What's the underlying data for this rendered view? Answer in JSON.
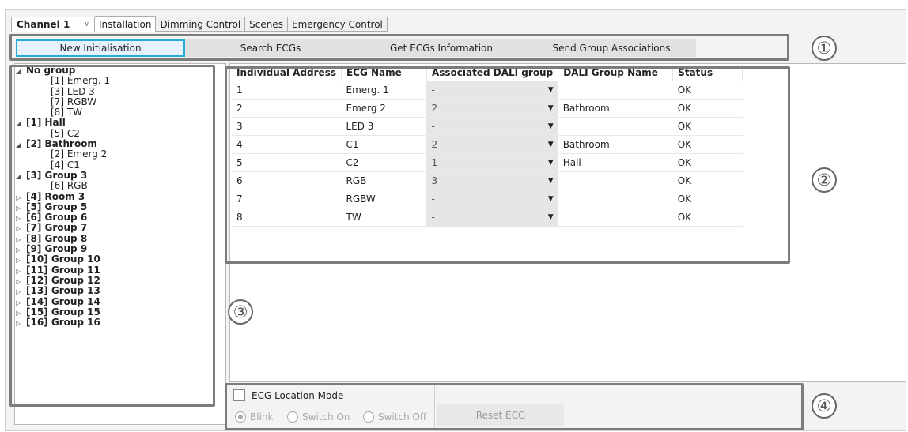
{
  "tabbar": {
    "channel_select": "Channel 1",
    "tabs": [
      "Installation",
      "Dimming Control",
      "Scenes",
      "Emergency Control"
    ],
    "active_tab": 0
  },
  "toolbar": {
    "new_init": "New Initialisation",
    "search": "Search ECGs",
    "get_info": "Get ECGs Information",
    "send_assoc": "Send Group Associations"
  },
  "callouts": [
    "①",
    "②",
    "③",
    "④"
  ],
  "tree": [
    {
      "label": "No group",
      "expanded": true,
      "children": [
        "[1] Emerg. 1",
        "[3] LED 3",
        "[7] RGBW",
        "[8] TW"
      ]
    },
    {
      "label": "[1] Hall",
      "expanded": true,
      "children": [
        "[5] C2"
      ]
    },
    {
      "label": "[2] Bathroom",
      "expanded": true,
      "children": [
        "[2] Emerg 2",
        "[4] C1"
      ]
    },
    {
      "label": "[3] Group 3",
      "expanded": true,
      "children": [
        "[6] RGB"
      ]
    },
    {
      "label": "[4] Room 3",
      "expanded": false,
      "children": []
    },
    {
      "label": "[5] Group 5",
      "expanded": false,
      "children": []
    },
    {
      "label": "[6] Group 6",
      "expanded": false,
      "children": []
    },
    {
      "label": "[7] Group 7",
      "expanded": false,
      "children": []
    },
    {
      "label": "[8] Group 8",
      "expanded": false,
      "children": []
    },
    {
      "label": "[9] Group 9",
      "expanded": false,
      "children": []
    },
    {
      "label": "[10] Group 10",
      "expanded": false,
      "children": []
    },
    {
      "label": "[11] Group 11",
      "expanded": false,
      "children": []
    },
    {
      "label": "[12] Group 12",
      "expanded": false,
      "children": []
    },
    {
      "label": "[13] Group 13",
      "expanded": false,
      "children": []
    },
    {
      "label": "[14] Group 14",
      "expanded": false,
      "children": []
    },
    {
      "label": "[15] Group 15",
      "expanded": false,
      "children": []
    },
    {
      "label": "[16] Group 16",
      "expanded": false,
      "children": []
    }
  ],
  "grid": {
    "headers": [
      "Individual Address",
      "ECG Name",
      "Associated DALI group",
      "DALI Group Name",
      "Status"
    ],
    "rows": [
      [
        "1",
        "Emerg. 1",
        "-",
        "",
        "OK"
      ],
      [
        "2",
        "Emerg 2",
        "2",
        "Bathroom",
        "OK"
      ],
      [
        "3",
        "LED 3",
        "-",
        "",
        "OK"
      ],
      [
        "4",
        "C1",
        "2",
        "Bathroom",
        "OK"
      ],
      [
        "5",
        "C2",
        "1",
        "Hall",
        "OK"
      ],
      [
        "6",
        "RGB",
        "3",
        "",
        "OK"
      ],
      [
        "7",
        "RGBW",
        "-",
        "",
        "OK"
      ],
      [
        "8",
        "TW",
        "-",
        "",
        "OK"
      ]
    ]
  },
  "location": {
    "checkbox_label": "ECG Location Mode",
    "radios": [
      "Blink",
      "Switch On",
      "Switch Off"
    ],
    "selected_radio": 0,
    "reset": "Reset ECG"
  },
  "icons": {
    "expanded": "triangle-expanded-icon",
    "collapsed": "triangle-collapsed-icon",
    "dropdown": "chevron-down-icon"
  }
}
